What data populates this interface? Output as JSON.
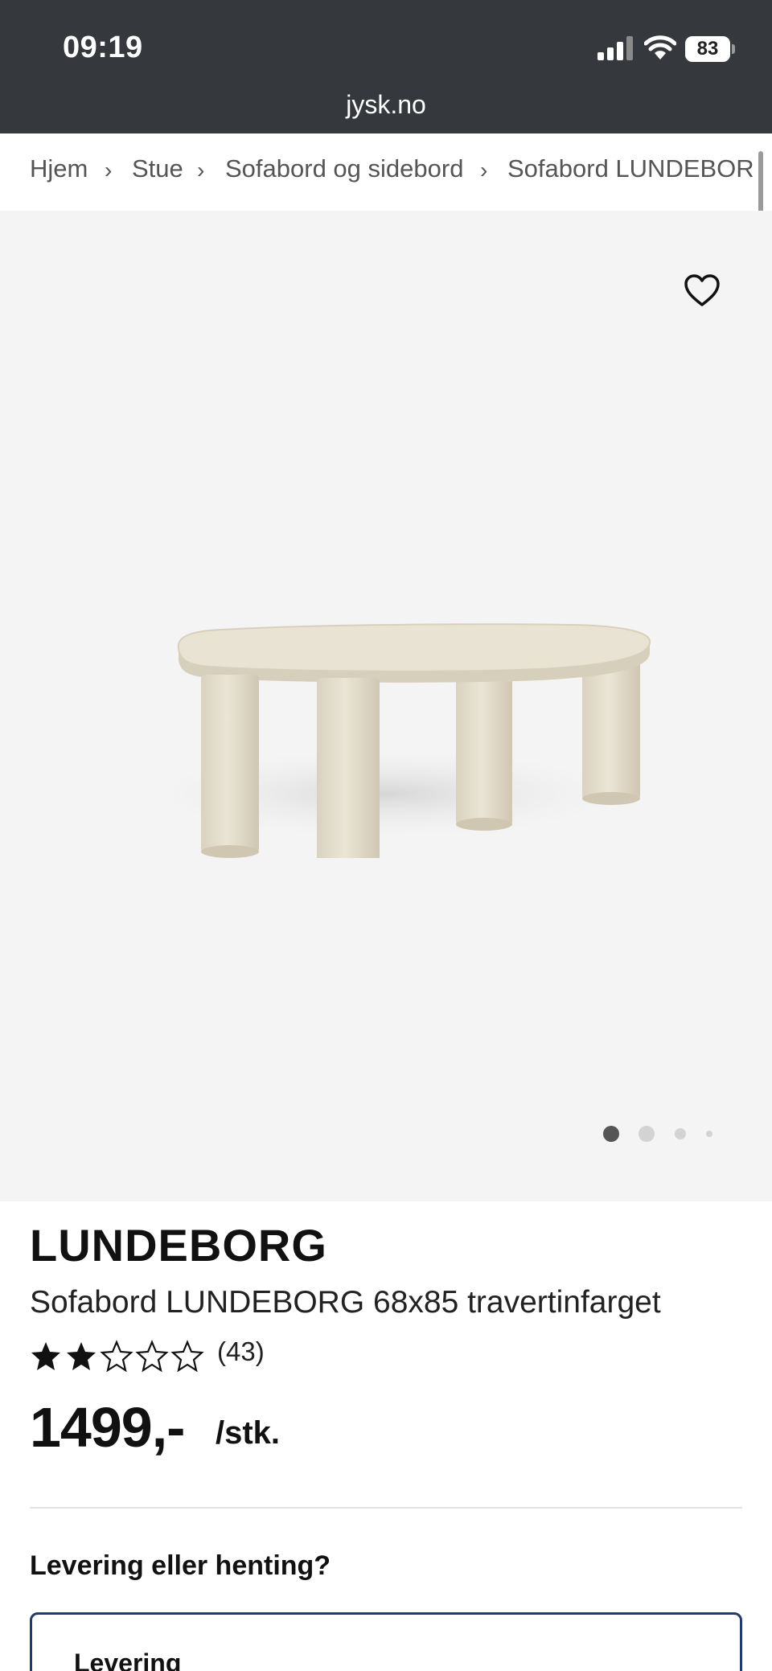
{
  "status_bar": {
    "time": "09:19",
    "battery": "83"
  },
  "browser": {
    "url": "jysk.no"
  },
  "breadcrumb": {
    "items": [
      {
        "label": "Hjem"
      },
      {
        "label": "Stue"
      },
      {
        "label": "Sofabord og sidebord"
      },
      {
        "label": "Sofabord LUNDEBOR"
      }
    ]
  },
  "gallery": {
    "image_count": 4,
    "active_index": 0
  },
  "product": {
    "brand": "LUNDEBORG",
    "name": "Sofabord LUNDEBORG 68x85 travertinfarget",
    "rating": 2.5,
    "rating_max": 5,
    "review_count": "(43)",
    "price": "1499,-",
    "unit": "/stk."
  },
  "delivery": {
    "question": "Levering eller henting?",
    "option_title": "Levering"
  },
  "colors": {
    "topbar": "#35383c",
    "image_bg": "#f4f4f4",
    "accent_border": "#1f3a6e",
    "travertine": "#e8e2d2"
  }
}
